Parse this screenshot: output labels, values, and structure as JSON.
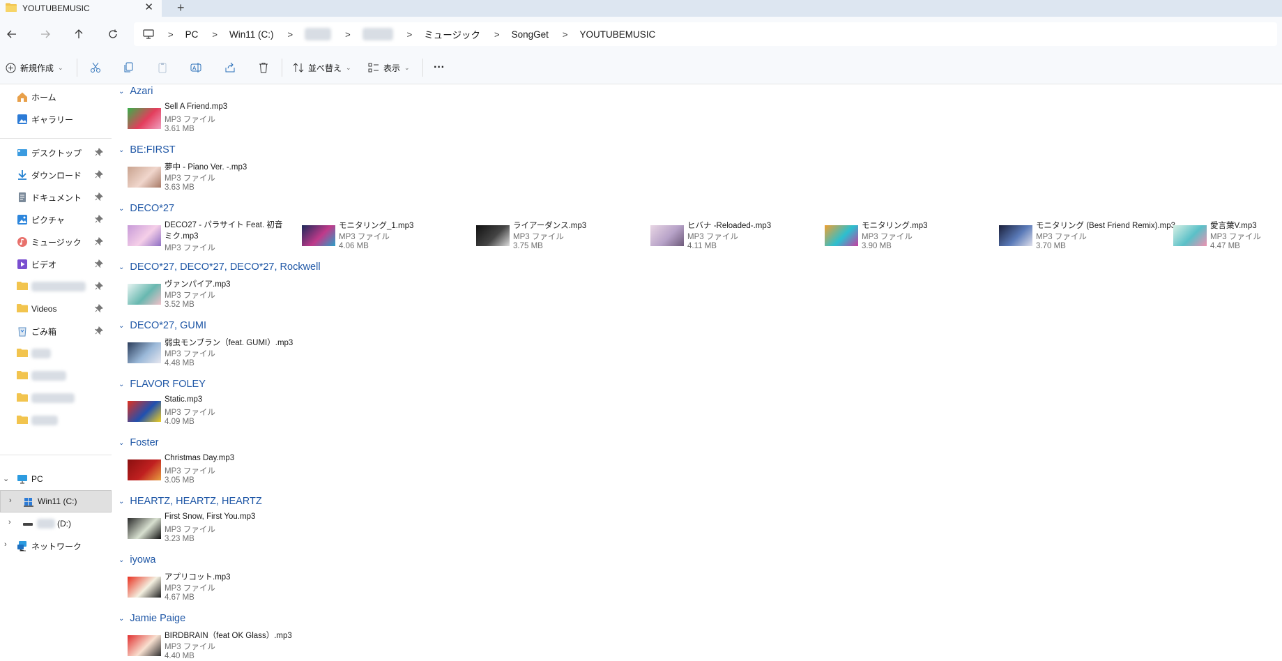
{
  "window": {
    "tab_title": "YOUTUBEMUSIC",
    "tab_close": "✕",
    "new_tab": "+"
  },
  "address": {
    "crumbs": [
      "PC",
      "Win11 (C:)",
      "",
      "",
      "ミュージック",
      "SongGet",
      "YOUTUBEMUSIC"
    ],
    "separator": ">"
  },
  "commands": {
    "new": "新規作成",
    "sort": "並べ替え",
    "view": "表示",
    "more": "···"
  },
  "sidebar": {
    "home": "ホーム",
    "gallery": "ギャラリー",
    "pinned": [
      {
        "label": "デスクトップ",
        "icon": "desktop-icon"
      },
      {
        "label": "ダウンロード",
        "icon": "download-icon"
      },
      {
        "label": "ドキュメント",
        "icon": "document-icon"
      },
      {
        "label": "ピクチャ",
        "icon": "pictures-icon"
      },
      {
        "label": "ミュージック",
        "icon": "music-icon"
      },
      {
        "label": "ビデオ",
        "icon": "video-icon"
      },
      {
        "label": "",
        "icon": "folder-icon"
      },
      {
        "label": "Videos",
        "icon": "folder-icon"
      },
      {
        "label": "ごみ箱",
        "icon": "recycle-bin-icon"
      }
    ],
    "pc": "PC",
    "drive_c": "Win11 (C:)",
    "drive_d": "(D:)",
    "network": "ネットワーク"
  },
  "groups": [
    {
      "name": "Azari",
      "files": [
        {
          "name": "Sell A Friend.mp3",
          "type": "MP3 ファイル",
          "size": "3.61 MB"
        }
      ]
    },
    {
      "name": "BE:FIRST",
      "files": [
        {
          "name": "夢中 - Piano Ver. -.mp3",
          "type": "MP3 ファイル",
          "size": "3.63 MB"
        }
      ]
    },
    {
      "name": "DECO*27",
      "files": [
        {
          "name": "DECO27 - パラサイト Feat. 初音ミク.mp3",
          "type": "MP3 ファイル",
          "size": ""
        },
        {
          "name": "モニタリング_1.mp3",
          "type": "MP3 ファイル",
          "size": "4.06 MB"
        },
        {
          "name": "ライアーダンス.mp3",
          "type": "MP3 ファイル",
          "size": "3.75 MB"
        },
        {
          "name": "ヒバナ -Reloaded-.mp3",
          "type": "MP3 ファイル",
          "size": "4.11 MB"
        },
        {
          "name": "モニタリング.mp3",
          "type": "MP3 ファイル",
          "size": "3.90 MB"
        },
        {
          "name": "モニタリング (Best Friend Remix).mp3",
          "type": "MP3 ファイル",
          "size": "3.70 MB"
        },
        {
          "name": "愛言葉V.mp3",
          "type": "MP3 ファイル",
          "size": "4.47 MB"
        }
      ]
    },
    {
      "name": "DECO*27, DECO*27, DECO*27, Rockwell",
      "files": [
        {
          "name": "ヴァンパイア.mp3",
          "type": "MP3 ファイル",
          "size": "3.52 MB"
        }
      ]
    },
    {
      "name": "DECO*27, GUMI",
      "files": [
        {
          "name": "弱虫モンブラン（feat. GUMI）.mp3",
          "type": "MP3 ファイル",
          "size": "4.48 MB"
        }
      ]
    },
    {
      "name": "FLAVOR FOLEY",
      "files": [
        {
          "name": "Static.mp3",
          "type": "MP3 ファイル",
          "size": "4.09 MB"
        }
      ]
    },
    {
      "name": "Foster",
      "files": [
        {
          "name": "Christmas Day.mp3",
          "type": "MP3 ファイル",
          "size": "3.05 MB"
        }
      ]
    },
    {
      "name": "HEARTZ, HEARTZ, HEARTZ",
      "files": [
        {
          "name": "First Snow, First You.mp3",
          "type": "MP3 ファイル",
          "size": "3.23 MB"
        }
      ]
    },
    {
      "name": "iyowa",
      "files": [
        {
          "name": "アプリコット.mp3",
          "type": "MP3 ファイル",
          "size": "4.67 MB"
        }
      ]
    },
    {
      "name": "Jamie Paige",
      "files": [
        {
          "name": "BIRDBRAIN（feat OK Glass）.mp3",
          "type": "MP3 ファイル",
          "size": "4.40 MB"
        }
      ]
    }
  ]
}
